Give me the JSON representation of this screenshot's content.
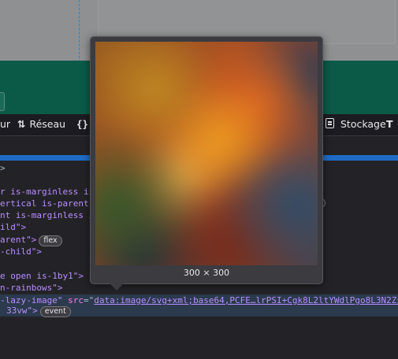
{
  "toolbar": {
    "partial_tab": "ur",
    "network_icon": "⇅",
    "network_label": "Réseau",
    "style_label": "{}",
    "storage_label": "Stockage",
    "edge_label": "T"
  },
  "dom_lines": [
    {
      "text": ">"
    },
    {
      "text": "r is-marginless is-"
    },
    {
      "text": "ertical is-parent i"
    },
    {
      "text": "nt is-marginless is"
    },
    {
      "text": "ild\">"
    },
    {
      "pre": "arent\">",
      "badge": "flex"
    },
    {
      "text": "-child\">"
    },
    {
      "text": "e open is-1by1\">"
    },
    {
      "text": "n-rainbows\">"
    },
    {
      "cls": "-lazy-image\"",
      "attr": "src",
      "src": "data:image/svg+xml;base64,PCFE…lrPSI+Cgk8L2ltYWdlPgo8L3N2Zz4="
    },
    {
      "tail": "33vw\">",
      "badge": "event"
    }
  ],
  "tooltip": {
    "dimensions": "300 × 300"
  },
  "colors": {
    "tag": "#75bfff",
    "attribute": "#ff7de9",
    "value": "#b98eff",
    "selection": "#2b3a4d",
    "accent_blue": "#1e6bc4"
  }
}
